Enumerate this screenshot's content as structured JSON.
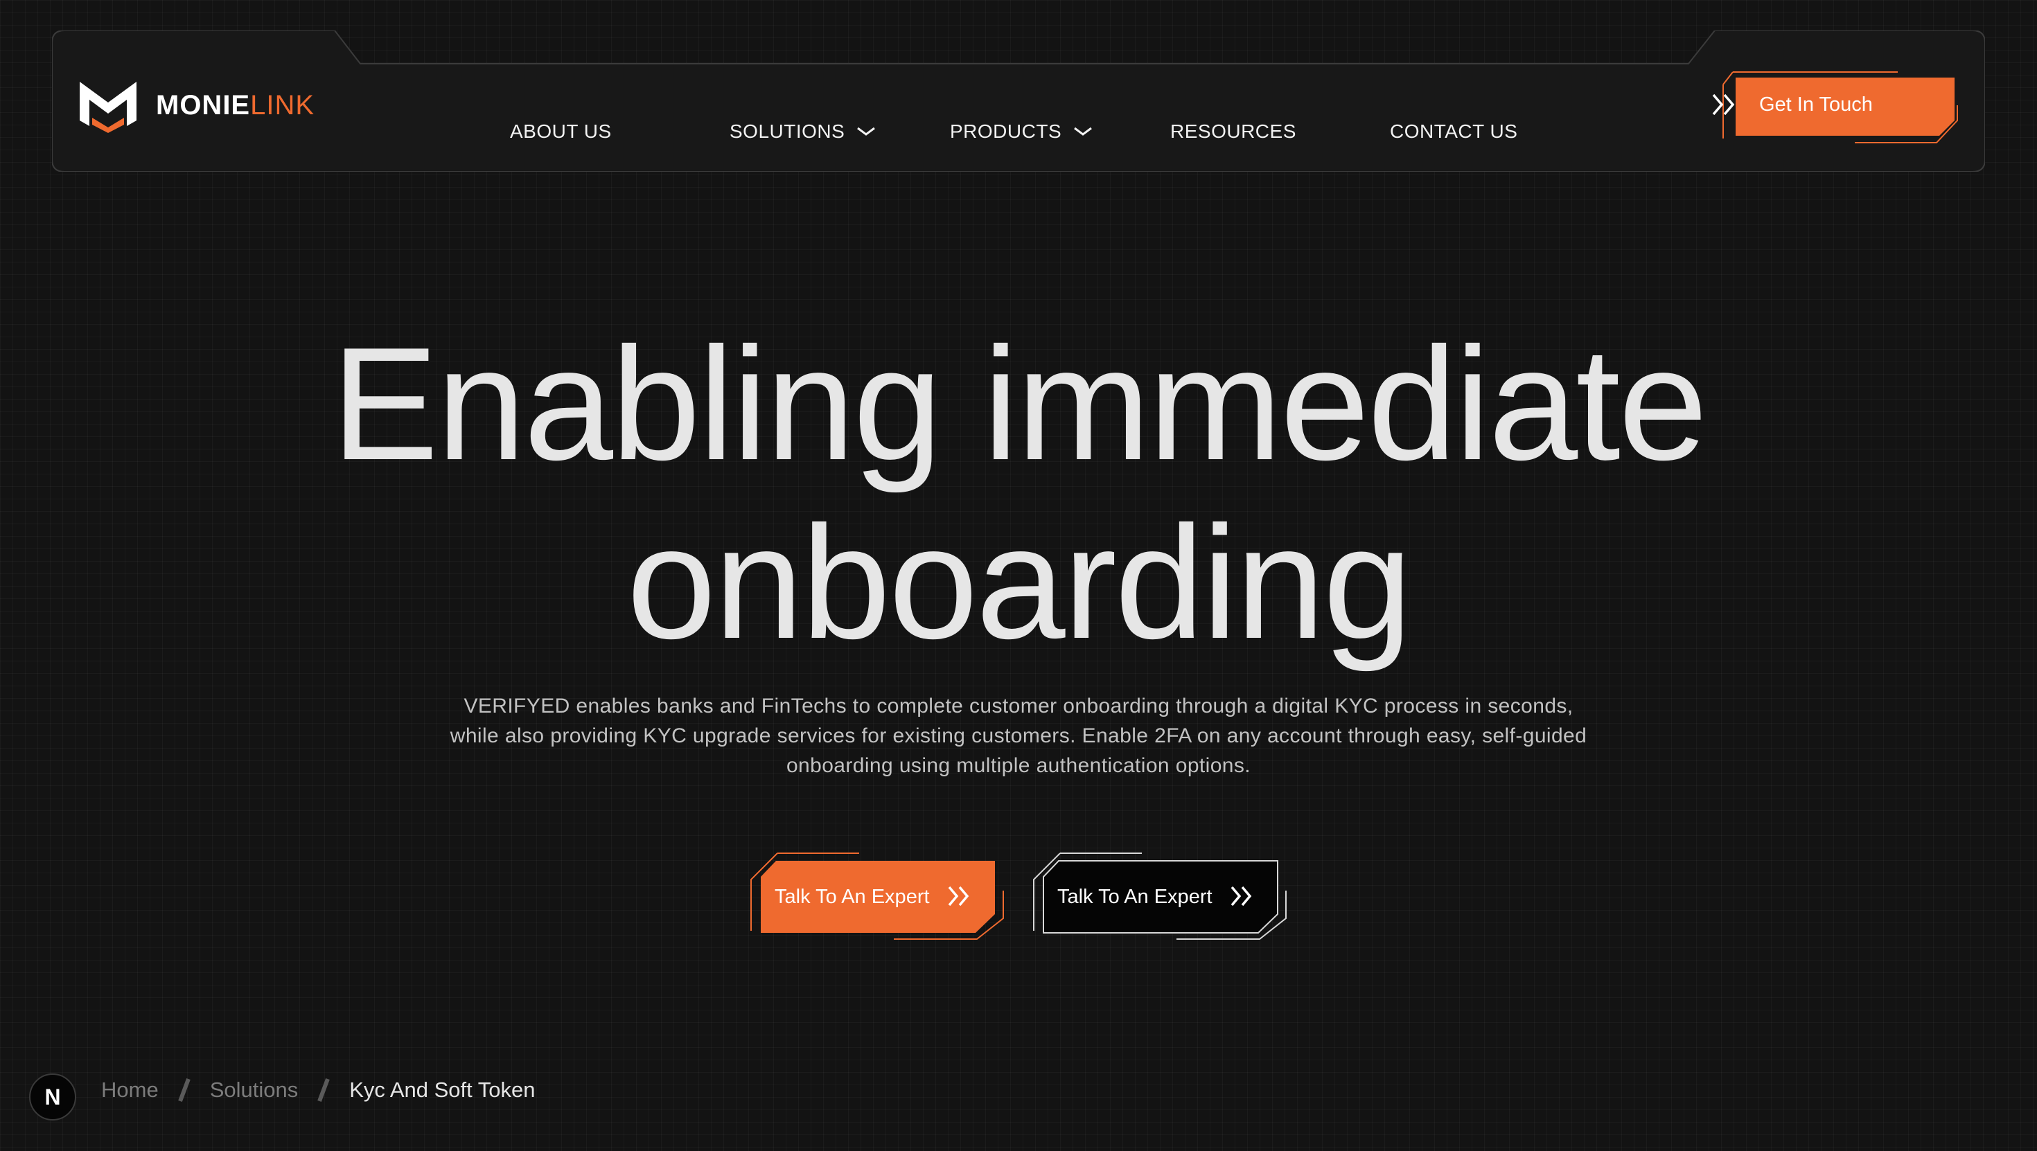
{
  "brand": {
    "name_primary": "MONIE",
    "name_accent": "LINK",
    "accent_color": "#ef6a2f",
    "logo_icon": "m-shield-logo"
  },
  "nav": {
    "items": [
      {
        "label": "ABOUT US",
        "has_dropdown": false
      },
      {
        "label": "SOLUTIONS",
        "has_dropdown": true
      },
      {
        "label": "PRODUCTS",
        "has_dropdown": true
      },
      {
        "label": "RESOURCES",
        "has_dropdown": false
      },
      {
        "label": "CONTACT US",
        "has_dropdown": false
      }
    ],
    "cta_label": "Get In Touch",
    "chevron_icon": "chevron-down-icon"
  },
  "hero": {
    "title_line1": "Enabling immediate",
    "title_line2": "onboarding",
    "description": "VERIFYED enables banks and FinTechs to complete customer onboarding through a digital KYC process in seconds, while also providing KYC upgrade services for existing customers. Enable 2FA on any account through easy, self-guided onboarding using multiple authentication options.",
    "primary_cta": "Talk To An Expert",
    "secondary_cta": "Talk To An Expert",
    "cta_icon": "double-chevron-right-icon"
  },
  "breadcrumb": {
    "items": [
      "Home",
      "Solutions",
      "Kyc And Soft Token"
    ]
  },
  "devtools_badge": "N",
  "colors": {
    "background": "#131313",
    "accent": "#ef6a2f",
    "text": "#e6e6e6",
    "muted": "#7c7c7c"
  }
}
